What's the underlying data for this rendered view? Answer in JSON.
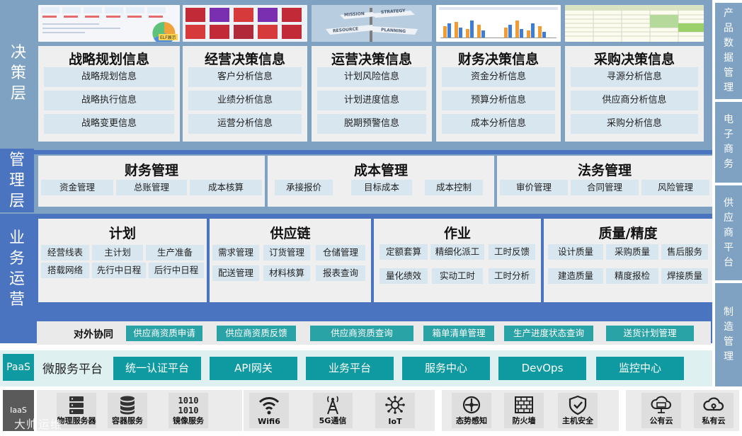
{
  "colors": {
    "steel_blue": "#7fa2c2",
    "royal_blue": "#4a73c0",
    "teal": "#0e9aa0",
    "light_box": "#d8e6ef",
    "panel": "#efefef"
  },
  "left_labels": {
    "decision": "决策层",
    "management": "管理层",
    "business": "业务运营",
    "paas": "PaaS",
    "iaas": "IaaS"
  },
  "right_labels": [
    "产品数据管理",
    "电子商务",
    "供应商平台",
    "制造管理"
  ],
  "decision": {
    "thumbnails": [
      {
        "name": "dashboard-screenshot",
        "caption": "ELF展示"
      },
      {
        "name": "tiles-screenshot"
      },
      {
        "name": "signpost-photo",
        "signs": [
          "MISSION",
          "STRATEGY",
          "RESOURCE",
          "PLANNING"
        ]
      },
      {
        "name": "bar-chart-screenshot"
      },
      {
        "name": "spreadsheet-screenshot"
      }
    ],
    "columns": [
      {
        "title": "战略规划信息",
        "items": [
          "战略规划信息",
          "战略执行信息",
          "战略变更信息"
        ]
      },
      {
        "title": "经营决策信息",
        "items": [
          "客户分析信息",
          "业绩分析信息",
          "运营分析信息"
        ]
      },
      {
        "title": "运营决策信息",
        "items": [
          "计划风险信息",
          "计划进度信息",
          "脱期预警信息"
        ]
      },
      {
        "title": "财务决策信息",
        "items": [
          "资金分析信息",
          "预算分析信息",
          "成本分析信息"
        ]
      },
      {
        "title": "采购决策信息",
        "items": [
          "寻源分析信息",
          "供应商分析信息",
          "采购分析信息"
        ]
      }
    ]
  },
  "management": {
    "modules": [
      {
        "title": "财务管理",
        "items": [
          "资金管理",
          "总账管理",
          "成本核算"
        ]
      },
      {
        "title": "成本管理",
        "items": [
          "承接报价",
          "目标成本",
          "成本控制"
        ]
      },
      {
        "title": "法务管理",
        "items": [
          "审价管理",
          "合同管理",
          "风险管理"
        ]
      }
    ]
  },
  "business": {
    "modules": [
      {
        "title": "计划",
        "rows": [
          [
            "经营线表",
            "主计划",
            "生产准备"
          ],
          [
            "搭载网络",
            "先行中日程",
            "后行中日程"
          ]
        ]
      },
      {
        "title": "供应链",
        "rows": [
          [
            "需求管理",
            "订货管理",
            "仓储管理"
          ],
          [
            "配送管理",
            "材料核算",
            "报表查询"
          ]
        ]
      },
      {
        "title": "作业",
        "rows": [
          [
            "定额套算",
            "精细化派工",
            "工时反馈"
          ],
          [
            "量化绩效",
            "实动工时",
            "工时分析"
          ]
        ]
      },
      {
        "title": "质量/精度",
        "rows": [
          [
            "设计质量",
            "采购质量",
            "售后服务"
          ],
          [
            "建造质量",
            "精度报检",
            "焊接质量"
          ]
        ]
      }
    ],
    "collaboration": {
      "title": "对外协同",
      "items": [
        "供应商资质申请",
        "供应商资质反馈",
        "供应商资质查询",
        "箱单清单管理",
        "生产进度状态查询",
        "送货计划管理"
      ]
    }
  },
  "paas": {
    "title": "微服务平台",
    "items": [
      "统一认证平台",
      "API网关",
      "业务平台",
      "服务中心",
      "DevOps",
      "监控中心"
    ]
  },
  "iaas": {
    "groups": [
      {
        "items": [
          {
            "label": "物理服务器",
            "icon": "server-rack-icon"
          },
          {
            "label": "容器服务",
            "icon": "database-stack-icon"
          },
          {
            "label": "镜像服务",
            "icon": "binary-digits-icon"
          }
        ]
      },
      {
        "items": [
          {
            "label": "Wifi6",
            "icon": "wifi-icon"
          },
          {
            "label": "5G通信",
            "icon": "antenna-tower-icon"
          },
          {
            "label": "IoT",
            "icon": "iot-network-icon"
          }
        ]
      },
      {
        "items": [
          {
            "label": "态势感知",
            "icon": "situational-awareness-icon"
          },
          {
            "label": "防火墙",
            "icon": "firewall-brick-icon"
          },
          {
            "label": "主机安全",
            "icon": "shield-check-icon"
          }
        ]
      },
      {
        "items": [
          {
            "label": "公有云",
            "icon": "public-cloud-icon"
          },
          {
            "label": "私有云",
            "icon": "private-cloud-icon"
          }
        ]
      }
    ]
  },
  "watermark": "大帅运维"
}
